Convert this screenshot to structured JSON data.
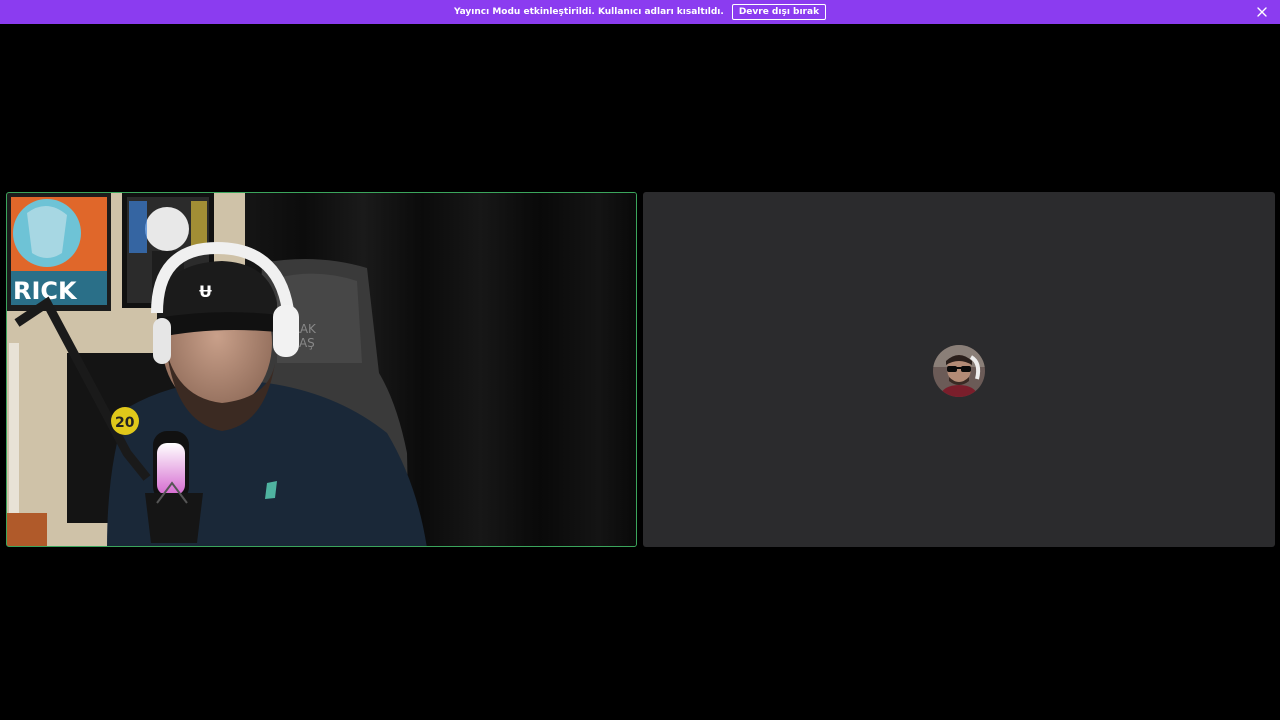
{
  "banner": {
    "message": "Yayıncı Modu etkinleştirildi. Kullanıcı adları kısaltıldı.",
    "disable_label": "Devre dışı bırak",
    "close_icon": "close-icon",
    "color": "#8b3cf0"
  },
  "participants": [
    {
      "kind": "video",
      "speaking": true,
      "speaking_color": "#3ba55c",
      "poster_text": "RICK",
      "chair_text": "RAK\nLAŞ",
      "mic_text": "20"
    },
    {
      "kind": "avatar",
      "tile_color": "#2b2b2d"
    }
  ]
}
